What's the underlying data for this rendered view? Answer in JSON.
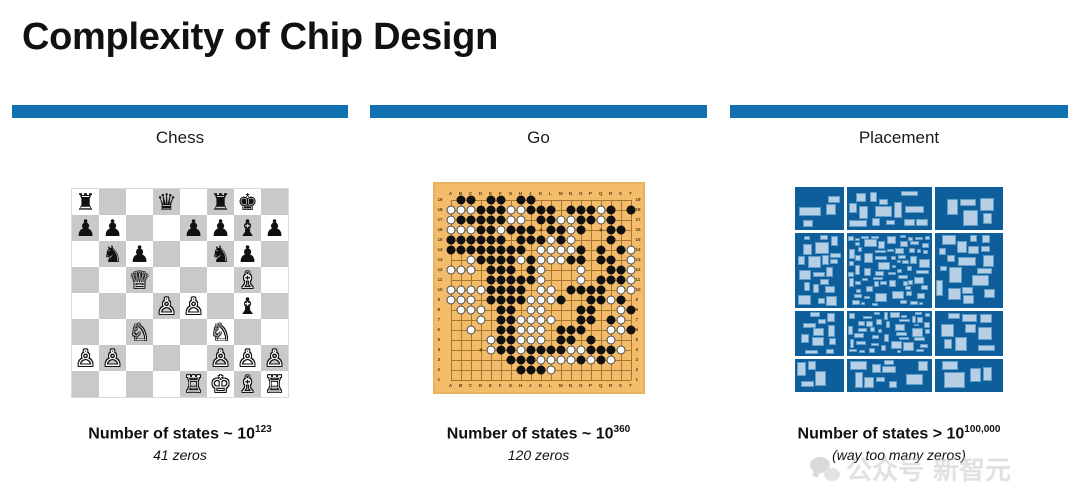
{
  "slide": {
    "title": "Complexity of Chip Design",
    "accent_color": "#1270b0",
    "background": "#ffffff"
  },
  "columns": [
    {
      "id": "chess",
      "heading": "Chess",
      "figure": "chess-board-diagram",
      "caption_main_prefix": "Number of states ~ 10",
      "caption_main_exponent": "123",
      "caption_sub": "41 zeros"
    },
    {
      "id": "go",
      "heading": "Go",
      "figure": "go-board-diagram",
      "caption_main_prefix": "Number of states ~ 10",
      "caption_main_exponent": "360",
      "caption_sub": "120 zeros"
    },
    {
      "id": "placement",
      "heading": "Placement",
      "figure": "chip-placement-floorplan",
      "caption_main_prefix": "Number of states > 10",
      "caption_main_exponent": "100,000",
      "caption_sub": "(way too many zeros)"
    }
  ],
  "chess": {
    "light_square_color": "#ffffff",
    "dark_square_color": "#c9c9c9",
    "ranks": [
      [
        "br",
        "",
        "",
        "bq",
        "",
        "br",
        "bk",
        ""
      ],
      [
        "bp",
        "bp",
        "",
        "",
        "bp",
        "bp",
        "bb",
        "bp"
      ],
      [
        "",
        "bn",
        "bp",
        "",
        "",
        "bn",
        "bp",
        ""
      ],
      [
        "",
        "",
        "wq",
        "",
        "",
        "",
        "wb",
        ""
      ],
      [
        "",
        "",
        "",
        "wp",
        "wp",
        "",
        "bb",
        ""
      ],
      [
        "",
        "",
        "wn",
        "",
        "",
        "wn",
        "",
        ""
      ],
      [
        "wp",
        "wp",
        "",
        "",
        "",
        "wp",
        "wp",
        "wp"
      ],
      [
        "",
        "",
        "",
        "",
        "wr",
        "wk",
        "wb",
        "wr"
      ]
    ],
    "glyphs": {
      "wk": "♔",
      "wq": "♕",
      "wr": "♖",
      "wb": "♗",
      "wn": "♘",
      "wp": "♙",
      "bk": "♚",
      "bq": "♛",
      "br": "♜",
      "bb": "♝",
      "bn": "♞",
      "bp": "♟"
    }
  },
  "go": {
    "board_size": 19,
    "board_color": "#f3bc6b",
    "column_labels": [
      "A",
      "B",
      "C",
      "D",
      "E",
      "F",
      "G",
      "H",
      "J",
      "K",
      "L",
      "M",
      "N",
      "O",
      "P",
      "Q",
      "R",
      "S",
      "T"
    ],
    "row_labels": [
      "19",
      "18",
      "17",
      "16",
      "15",
      "14",
      "13",
      "12",
      "11",
      "10",
      "9",
      "8",
      "7",
      "6",
      "5",
      "4",
      "3",
      "2",
      "1"
    ],
    "black_stones": [
      [
        1,
        18
      ],
      [
        2,
        18
      ],
      [
        4,
        18
      ],
      [
        5,
        18
      ],
      [
        7,
        18
      ],
      [
        8,
        18
      ],
      [
        3,
        17
      ],
      [
        4,
        17
      ],
      [
        5,
        17
      ],
      [
        8,
        17
      ],
      [
        9,
        17
      ],
      [
        10,
        17
      ],
      [
        12,
        17
      ],
      [
        13,
        17
      ],
      [
        14,
        17
      ],
      [
        16,
        17
      ],
      [
        18,
        17
      ],
      [
        1,
        16
      ],
      [
        2,
        16
      ],
      [
        3,
        16
      ],
      [
        4,
        16
      ],
      [
        5,
        16
      ],
      [
        9,
        16
      ],
      [
        10,
        16
      ],
      [
        13,
        16
      ],
      [
        14,
        16
      ],
      [
        16,
        16
      ],
      [
        3,
        15
      ],
      [
        4,
        15
      ],
      [
        6,
        15
      ],
      [
        7,
        15
      ],
      [
        8,
        15
      ],
      [
        10,
        15
      ],
      [
        11,
        15
      ],
      [
        13,
        15
      ],
      [
        16,
        15
      ],
      [
        17,
        15
      ],
      [
        0,
        14
      ],
      [
        1,
        14
      ],
      [
        2,
        14
      ],
      [
        3,
        14
      ],
      [
        4,
        14
      ],
      [
        5,
        14
      ],
      [
        7,
        14
      ],
      [
        8,
        14
      ],
      [
        9,
        14
      ],
      [
        11,
        14
      ],
      [
        16,
        14
      ],
      [
        0,
        13
      ],
      [
        1,
        13
      ],
      [
        2,
        13
      ],
      [
        3,
        13
      ],
      [
        4,
        13
      ],
      [
        5,
        13
      ],
      [
        6,
        13
      ],
      [
        7,
        13
      ],
      [
        13,
        13
      ],
      [
        15,
        13
      ],
      [
        17,
        13
      ],
      [
        3,
        12
      ],
      [
        4,
        12
      ],
      [
        5,
        12
      ],
      [
        6,
        12
      ],
      [
        8,
        12
      ],
      [
        12,
        12
      ],
      [
        13,
        12
      ],
      [
        15,
        12
      ],
      [
        16,
        12
      ],
      [
        4,
        11
      ],
      [
        5,
        11
      ],
      [
        6,
        11
      ],
      [
        8,
        11
      ],
      [
        16,
        11
      ],
      [
        17,
        11
      ],
      [
        4,
        10
      ],
      [
        5,
        10
      ],
      [
        6,
        10
      ],
      [
        7,
        10
      ],
      [
        8,
        10
      ],
      [
        15,
        10
      ],
      [
        16,
        10
      ],
      [
        17,
        10
      ],
      [
        4,
        9
      ],
      [
        5,
        9
      ],
      [
        6,
        9
      ],
      [
        7,
        9
      ],
      [
        12,
        9
      ],
      [
        13,
        9
      ],
      [
        14,
        9
      ],
      [
        15,
        9
      ],
      [
        4,
        8
      ],
      [
        5,
        8
      ],
      [
        6,
        8
      ],
      [
        7,
        8
      ],
      [
        11,
        8
      ],
      [
        14,
        8
      ],
      [
        15,
        8
      ],
      [
        17,
        8
      ],
      [
        5,
        7
      ],
      [
        6,
        7
      ],
      [
        13,
        7
      ],
      [
        14,
        7
      ],
      [
        18,
        7
      ],
      [
        5,
        6
      ],
      [
        6,
        6
      ],
      [
        13,
        6
      ],
      [
        14,
        6
      ],
      [
        16,
        6
      ],
      [
        5,
        5
      ],
      [
        6,
        5
      ],
      [
        11,
        5
      ],
      [
        12,
        5
      ],
      [
        13,
        5
      ],
      [
        18,
        5
      ],
      [
        5,
        4
      ],
      [
        6,
        4
      ],
      [
        11,
        4
      ],
      [
        12,
        4
      ],
      [
        14,
        4
      ],
      [
        5,
        3
      ],
      [
        6,
        3
      ],
      [
        8,
        3
      ],
      [
        9,
        3
      ],
      [
        10,
        3
      ],
      [
        11,
        3
      ],
      [
        14,
        3
      ],
      [
        15,
        3
      ],
      [
        16,
        3
      ],
      [
        6,
        2
      ],
      [
        7,
        2
      ],
      [
        8,
        2
      ],
      [
        13,
        2
      ],
      [
        15,
        2
      ],
      [
        7,
        1
      ],
      [
        8,
        1
      ],
      [
        9,
        1
      ]
    ],
    "white_stones": [
      [
        0,
        17
      ],
      [
        1,
        17
      ],
      [
        2,
        17
      ],
      [
        6,
        17
      ],
      [
        7,
        17
      ],
      [
        15,
        17
      ],
      [
        18,
        17
      ],
      [
        0,
        16
      ],
      [
        1,
        16
      ],
      [
        2,
        16
      ],
      [
        6,
        16
      ],
      [
        7,
        16
      ],
      [
        11,
        16
      ],
      [
        12,
        16
      ],
      [
        15,
        16
      ],
      [
        0,
        15
      ],
      [
        1,
        15
      ],
      [
        2,
        15
      ],
      [
        5,
        15
      ],
      [
        6,
        15
      ],
      [
        7,
        15
      ],
      [
        11,
        15
      ],
      [
        12,
        15
      ],
      [
        17,
        15
      ],
      [
        0,
        14
      ],
      [
        2,
        14
      ],
      [
        5,
        14
      ],
      [
        9,
        14
      ],
      [
        10,
        14
      ],
      [
        11,
        14
      ],
      [
        12,
        14
      ],
      [
        2,
        13
      ],
      [
        9,
        13
      ],
      [
        10,
        13
      ],
      [
        11,
        13
      ],
      [
        12,
        13
      ],
      [
        13,
        13
      ],
      [
        18,
        13
      ],
      [
        2,
        12
      ],
      [
        7,
        12
      ],
      [
        8,
        12
      ],
      [
        9,
        12
      ],
      [
        10,
        12
      ],
      [
        11,
        12
      ],
      [
        13,
        12
      ],
      [
        18,
        12
      ],
      [
        0,
        11
      ],
      [
        1,
        11
      ],
      [
        2,
        11
      ],
      [
        9,
        11
      ],
      [
        13,
        11
      ],
      [
        17,
        11
      ],
      [
        18,
        11
      ],
      [
        9,
        10
      ],
      [
        13,
        10
      ],
      [
        18,
        10
      ],
      [
        0,
        9
      ],
      [
        1,
        9
      ],
      [
        2,
        9
      ],
      [
        3,
        9
      ],
      [
        9,
        9
      ],
      [
        10,
        9
      ],
      [
        17,
        9
      ],
      [
        18,
        9
      ],
      [
        0,
        8
      ],
      [
        1,
        8
      ],
      [
        2,
        8
      ],
      [
        8,
        8
      ],
      [
        9,
        8
      ],
      [
        10,
        8
      ],
      [
        16,
        8
      ],
      [
        17,
        8
      ],
      [
        1,
        7
      ],
      [
        2,
        7
      ],
      [
        3,
        7
      ],
      [
        8,
        7
      ],
      [
        9,
        7
      ],
      [
        17,
        7
      ],
      [
        3,
        6
      ],
      [
        7,
        6
      ],
      [
        8,
        6
      ],
      [
        9,
        6
      ],
      [
        10,
        6
      ],
      [
        17,
        6
      ],
      [
        2,
        5
      ],
      [
        7,
        5
      ],
      [
        8,
        5
      ],
      [
        9,
        5
      ],
      [
        16,
        5
      ],
      [
        17,
        5
      ],
      [
        4,
        4
      ],
      [
        7,
        4
      ],
      [
        8,
        4
      ],
      [
        9,
        4
      ],
      [
        16,
        4
      ],
      [
        4,
        3
      ],
      [
        7,
        3
      ],
      [
        12,
        3
      ],
      [
        13,
        3
      ],
      [
        17,
        3
      ],
      [
        9,
        2
      ],
      [
        10,
        2
      ],
      [
        11,
        2
      ],
      [
        12,
        2
      ],
      [
        14,
        2
      ],
      [
        16,
        2
      ],
      [
        9,
        1
      ],
      [
        10,
        1
      ]
    ],
    "marked_stone": [
      4,
      8
    ],
    "star_points": [
      [
        3,
        3
      ],
      [
        9,
        3
      ],
      [
        15,
        3
      ],
      [
        3,
        9
      ],
      [
        9,
        9
      ],
      [
        15,
        9
      ],
      [
        3,
        15
      ],
      [
        9,
        15
      ],
      [
        15,
        15
      ]
    ]
  },
  "placement": {
    "background_color": "#0f5e9c",
    "block_color": "#b7cfe4",
    "block_border_color": "#5e9ec9",
    "channel_color": "#ffffff"
  },
  "watermark": {
    "text": "公众号 新智元",
    "logo": "wechat-logo"
  }
}
